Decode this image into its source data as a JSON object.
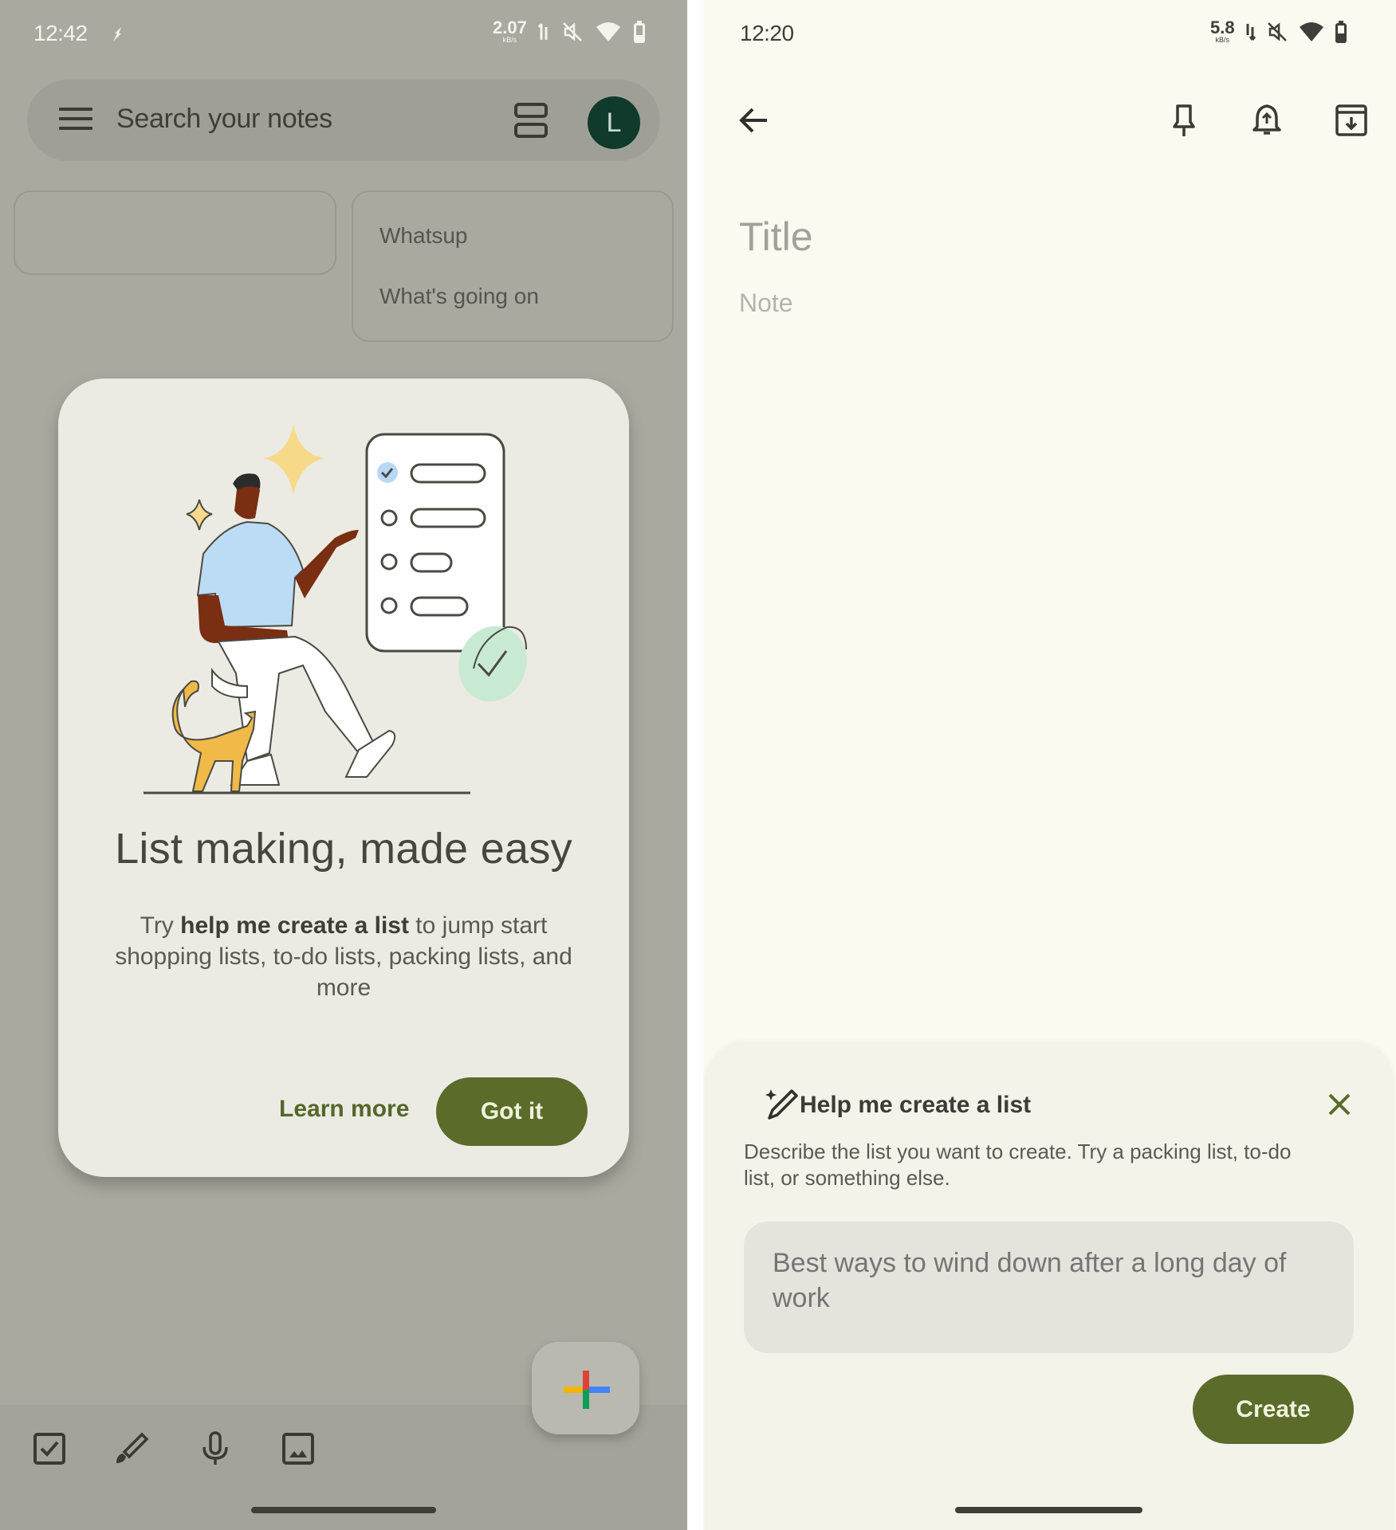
{
  "left_screen": {
    "status_bar": {
      "time": "12:42",
      "network_speed": "2.07",
      "network_unit": "kB/s",
      "icons": [
        "signal-icon",
        "mute-icon",
        "wifi-icon",
        "battery-icon"
      ]
    },
    "search_bar": {
      "placeholder": "Search your notes",
      "avatar_letter": "L"
    },
    "notes": [
      {
        "title": "",
        "body": ""
      },
      {
        "title": "Whatsup",
        "body": "What's going on"
      }
    ],
    "dialog": {
      "title": "List making, made easy",
      "body_prefix": "Try ",
      "body_bold": "help me create a list",
      "body_suffix": " to jump start shopping lists, to-do lists, packing lists, and more",
      "learn_more_label": "Learn more",
      "got_it_label": "Got it"
    },
    "bottom_toolbar": [
      "checkbox-icon",
      "brush-icon",
      "microphone-icon",
      "image-icon"
    ],
    "fab": "new-note-plus-icon"
  },
  "right_screen": {
    "status_bar": {
      "time": "12:20",
      "network_speed": "5.8",
      "network_unit": "kB/s",
      "icons": [
        "signal-icon",
        "mute-icon",
        "wifi-icon",
        "battery-icon"
      ]
    },
    "editor": {
      "title_placeholder": "Title",
      "note_placeholder": "Note"
    },
    "sheet": {
      "title": "Help me create a list",
      "description": "Describe the list you want to create. Try a packing list, to-do list, or something else.",
      "input_placeholder": "Best ways to wind down after a long day of work",
      "create_label": "Create"
    }
  },
  "colors": {
    "accent": "#5a6b2a",
    "avatar": "#0f3a2c",
    "scrim": "#a9a9a0",
    "surface": "#fafaf0"
  }
}
